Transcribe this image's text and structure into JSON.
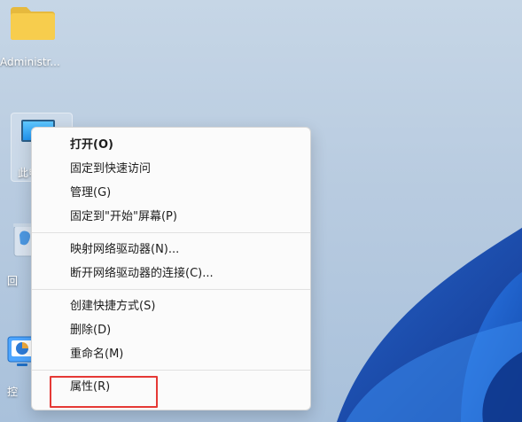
{
  "desktop": {
    "icons": [
      {
        "label": "Administr...",
        "name": "administrator-folder"
      },
      {
        "label": "此电",
        "name": "this-pc"
      },
      {
        "label": "回",
        "name": "recycle-bin"
      },
      {
        "label": "控",
        "name": "control-panel"
      }
    ]
  },
  "context_menu": {
    "groups": [
      [
        {
          "label": "打开(O)",
          "bold": true
        },
        {
          "label": "固定到快速访问"
        },
        {
          "label": "管理(G)"
        },
        {
          "label": "固定到\"开始\"屏幕(P)"
        }
      ],
      [
        {
          "label": "映射网络驱动器(N)..."
        },
        {
          "label": "断开网络驱动器的连接(C)..."
        }
      ],
      [
        {
          "label": "创建快捷方式(S)"
        },
        {
          "label": "删除(D)"
        },
        {
          "label": "重命名(M)"
        }
      ],
      [
        {
          "label": "属性(R)"
        }
      ]
    ]
  },
  "colors": {
    "highlight": "#e53935",
    "menu_bg": "#fbfbfb",
    "menu_text": "#1d1d1d",
    "folder_yellow": "#f3c749",
    "pc_screen_blue": "#2196f3"
  }
}
